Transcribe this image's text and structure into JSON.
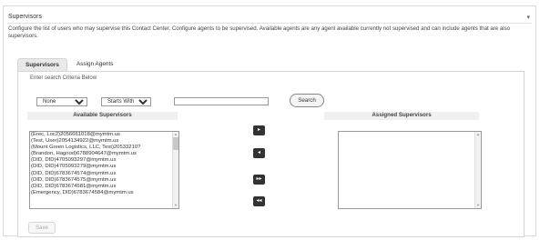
{
  "panel": {
    "title": "Supervisors",
    "description": "Configure the list of users who may supervise this Contact Center. Configure agents to be supervised. Available agents are any agent available currently not supervised and can include agents that are also supervisors."
  },
  "tabs": [
    {
      "label": "Supervisors",
      "active": true
    },
    {
      "label": "Assign Agents",
      "active": false
    }
  ],
  "search": {
    "criteria_label": "Enter search Criteria Below",
    "field_select": "None",
    "match_select": "Starts With",
    "text_value": "",
    "button_label": "Search"
  },
  "available": {
    "header": "Available Supervisors",
    "items": [
      "(Erec, Loc2)2056661018@mymtm.us",
      "(Test, User)2054134922@mymtm.us",
      "(Mount Green Logistics, LLC, Test)20533210?",
      "(Brandon, Hagood)6788904647@mymtm.us",
      "(DID, DID)4705093297@mymtm.us",
      "(DID, DID)4705093279@mymtm.us",
      "(DID, DID)6783674574@mymtm.us",
      "(DID, DID)6783674575@mymtm.us",
      "(DID, DID)6783674581@mymtm.us",
      "(Emergency, DID)6783674584@mymtm.us"
    ]
  },
  "assigned": {
    "header": "Assigned Supervisors",
    "items": []
  },
  "move_buttons": {
    "add": "▸",
    "remove": "◂",
    "add_all": "▸▸",
    "remove_all": "◂◂"
  },
  "save_label": "Save",
  "icons": {
    "collapse": "▾"
  }
}
